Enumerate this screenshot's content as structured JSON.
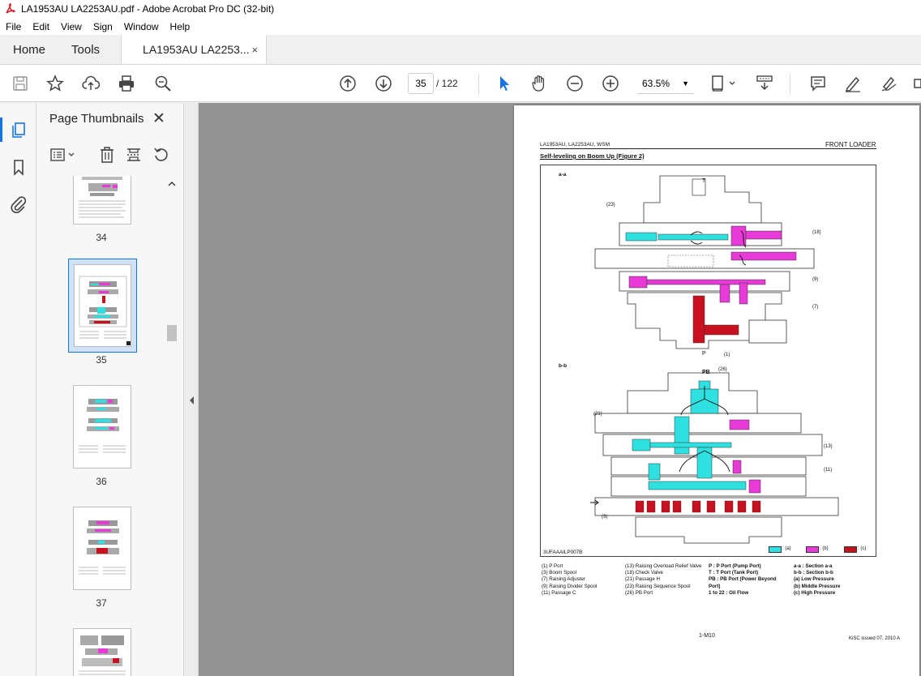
{
  "window": {
    "title": "LA1953AU LA2253AU.pdf - Adobe Acrobat Pro DC (32-bit)"
  },
  "menu": [
    "File",
    "Edit",
    "View",
    "Sign",
    "Window",
    "Help"
  ],
  "tabs": {
    "home": "Home",
    "tools": "Tools",
    "document": "LA1953AU LA2253...",
    "close": "×"
  },
  "toolbar": {
    "current_page": "35",
    "page_total": "/ 122",
    "zoom": "63.5%"
  },
  "panel": {
    "title": "Page Thumbnails",
    "close": "✕",
    "thumbnails": [
      {
        "label": "34"
      },
      {
        "label": "35",
        "selected": true
      },
      {
        "label": "36"
      },
      {
        "label": "37"
      }
    ]
  },
  "page": {
    "header_left": "LA1953AU, LA2253AU, WSM",
    "header_right": "FRONT LOADER",
    "section_title": "Self-leveling on Boom Up (Figure 2)",
    "section_aa": "a-a",
    "section_bb": "b-b",
    "figure_id": "3UFAAAILP007B",
    "port_T": "T",
    "port_P": "P",
    "port_PB": "PB",
    "callouts": {
      "c23": "(23)",
      "c18": "(18)",
      "c9": "(9)",
      "c7": "(7)",
      "c1": "(1)",
      "c26": "(26)",
      "c21": "(21)",
      "c13": "(13)",
      "c11": "(11)",
      "c3": "(3)"
    },
    "legend_keys": [
      ": (a)",
      ": (b)",
      ": (c)"
    ],
    "legend_colors": [
      "#2fe0e0",
      "#e83ad6",
      "#c8101e"
    ],
    "legend": {
      "col1": [
        "(1)   P Port",
        "(3)   Boom Spool",
        "(7)   Raising Adjuster",
        "(9)   Raising Divider Spool",
        "(11) Passage C"
      ],
      "col2": [
        "(13) Raising Overload Relief Valve",
        "(18) Check Valve",
        "(21) Passage H",
        "(23) Raising Sequence Spool",
        "(26) PB Port"
      ],
      "col3": [
        "P :   P Port (Pump Port)",
        "T :   T Port (Tank Port)",
        "PB : PB Port (Power Beyond",
        "        Port)",
        "1 to 22 : Oil Flow"
      ],
      "col4": [
        "a-a : Section a-a",
        "b-b : Section b-b",
        "(a)   Low Pressure",
        "(b)   Middle Pressure",
        "(c)   High Pressure"
      ]
    },
    "footer_center": "1-M10",
    "footer_right": "KiSC issued 07, 2010 A"
  },
  "colors": {
    "accent": "#1473e6",
    "cyan": "#2fe0e0",
    "magenta": "#e83ad6",
    "red": "#c8101e"
  }
}
